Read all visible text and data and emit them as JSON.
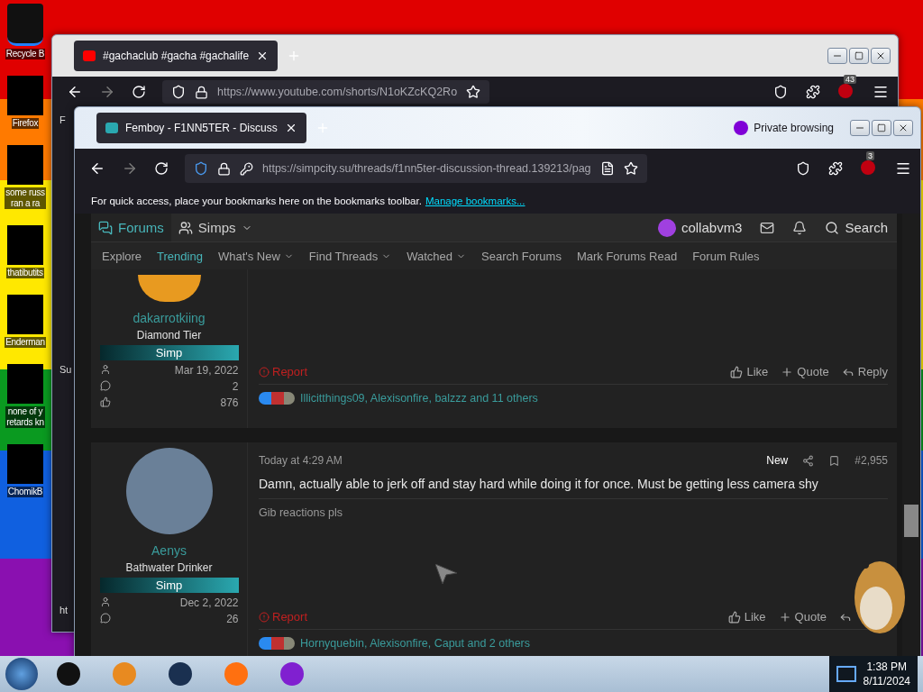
{
  "desktop": {
    "icons": [
      {
        "lines": [
          "Recycle B"
        ],
        "kind": "bin"
      },
      {
        "lines": [
          "Firefox"
        ],
        "kind": "app"
      },
      {
        "lines": [
          "some russ",
          "ran a ra"
        ],
        "kind": "app"
      },
      {
        "lines": [
          "thatibutits"
        ],
        "kind": "app"
      },
      {
        "lines": [
          "Enderman"
        ],
        "kind": "app"
      },
      {
        "lines": [
          "none of y",
          "retards kn"
        ],
        "kind": "app"
      },
      {
        "lines": [
          "ChomikB"
        ],
        "kind": "app"
      }
    ]
  },
  "back_window": {
    "tab": {
      "title": "#gachaclub #gacha #gachalife",
      "selected": true
    },
    "url": "https://www.youtube.com/shorts/N1oKZcKQ2Ro",
    "addon_badge": "43",
    "fragments": [
      "F",
      "Su",
      "ht"
    ]
  },
  "front_window": {
    "tab": {
      "title": "Femboy - F1NN5TER - Discuss",
      "selected": true
    },
    "private_label": "Private browsing",
    "url": "https://simpcity.su/threads/f1nn5ter-discussion-thread.139213/pag",
    "addon_badge": "3",
    "bookmarks_notice": "For quick access, place your bookmarks here on the bookmarks toolbar.",
    "bookmarks_link": "Manage bookmarks...",
    "nav": {
      "items": [
        {
          "label": "Forums",
          "selected": true,
          "dropdown": false
        },
        {
          "label": "Simps",
          "selected": false,
          "dropdown": true
        }
      ],
      "user": "collabvm3",
      "search": "Search"
    },
    "subnav": [
      {
        "label": "Explore",
        "selected": false,
        "dropdown": false
      },
      {
        "label": "Trending",
        "selected": true,
        "dropdown": false
      },
      {
        "label": "What's New",
        "selected": false,
        "dropdown": true
      },
      {
        "label": "Find Threads",
        "selected": false,
        "dropdown": true
      },
      {
        "label": "Watched",
        "selected": false,
        "dropdown": true
      },
      {
        "label": "Search Forums",
        "selected": false,
        "dropdown": false
      },
      {
        "label": "Mark Forums Read",
        "selected": false,
        "dropdown": false
      },
      {
        "label": "Forum Rules",
        "selected": false,
        "dropdown": false
      }
    ],
    "posts": [
      {
        "username": "dakarrotkiing",
        "user_title": "Diamond Tier",
        "rank": "Simp",
        "stats": [
          "Mar 19, 2022",
          "2",
          "876"
        ],
        "actions": [
          "Like",
          "Quote",
          "Reply"
        ],
        "report": "Report",
        "reactions": "Illicitthings09, Alexisonfire, balzzz and 11 others"
      },
      {
        "username": "Aenys",
        "user_title": "Bathwater Drinker",
        "rank": "Simp",
        "stats": [
          "Dec 2, 2022",
          "26"
        ],
        "date": "Today at 4:29 AM",
        "new_label": "New",
        "number": "#2,955",
        "body": "Damn, actually able to jerk off and stay hard while doing it for once. Must be getting less camera shy",
        "signature": "Gib reactions pls",
        "actions": [
          "Like",
          "Quote"
        ],
        "report": "Report",
        "reactions": "Hornyquebin, Alexisonfire, Caput and 2 others"
      }
    ]
  },
  "taskbar": {
    "time": "1:38 PM",
    "date": "8/11/2024"
  }
}
